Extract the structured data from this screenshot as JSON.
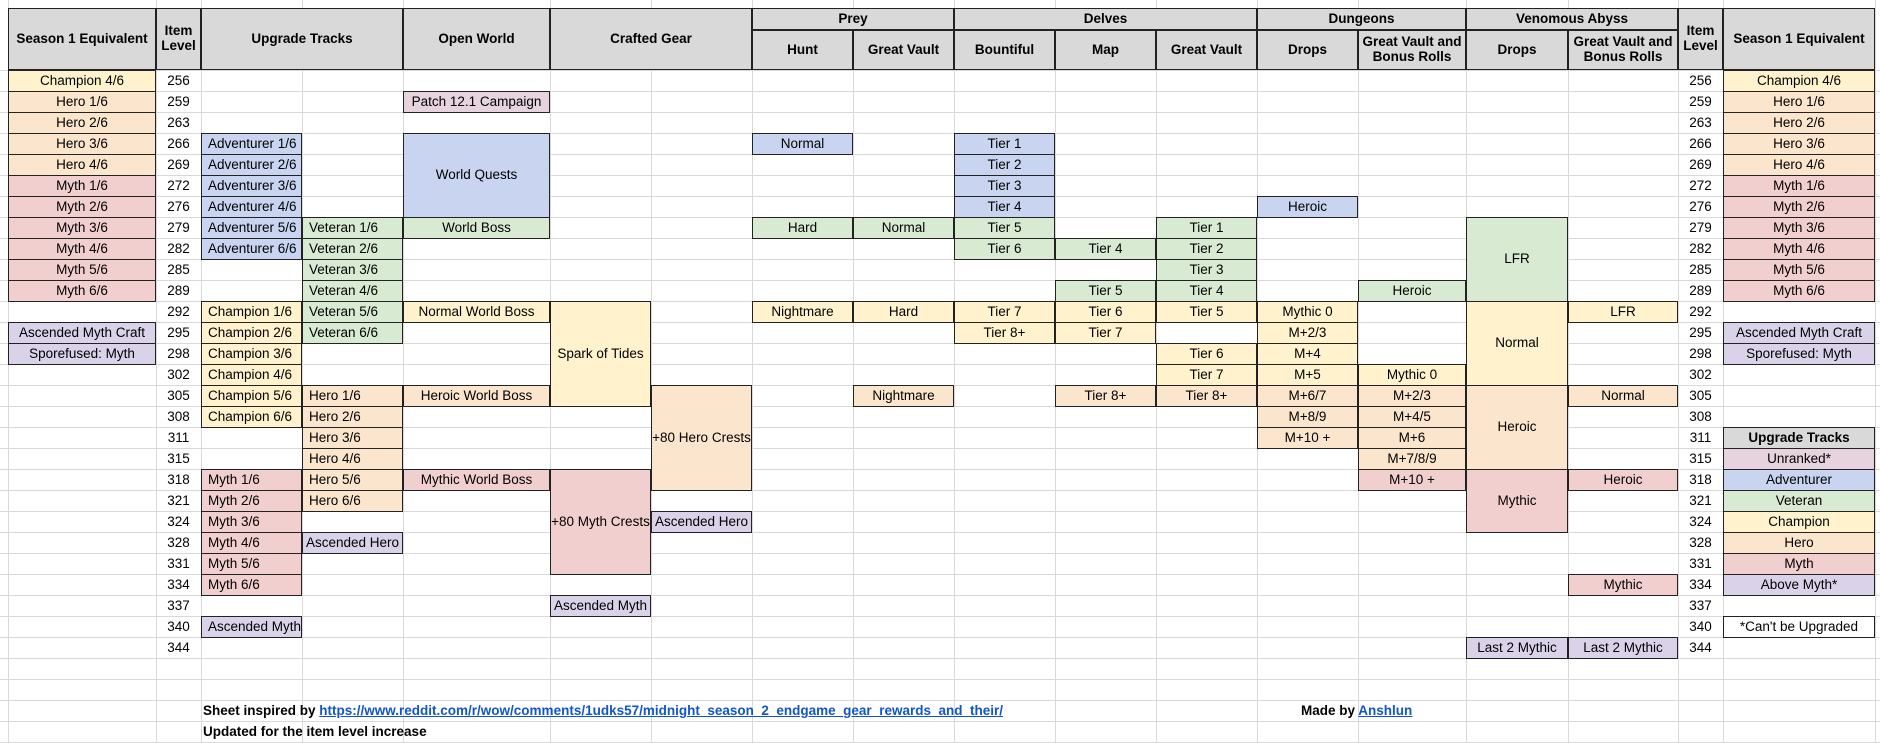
{
  "colors": {
    "header": "#d9d9d9",
    "unranked": "#e6d3dd",
    "adventurer": "#c9d5f0",
    "veteran": "#d9ead3",
    "champion": "#fff2cc",
    "hero": "#fce5cd",
    "myth": "#f2cfcf",
    "above_myth": "#d9d2e9",
    "link": "#1155cc"
  },
  "header": {
    "season_left": "Season 1 Equivalent",
    "item_level_left": "Item Level",
    "upgrade_tracks": "Upgrade Tracks",
    "open_world": "Open World",
    "crafted_gear": "Crafted Gear",
    "prey": "Prey",
    "prey_hunt": "Hunt",
    "prey_great_vault": "Great Vault",
    "delves": "Delves",
    "delves_bountiful": "Bountiful",
    "delves_map": "Map",
    "delves_great_vault": "Great Vault",
    "dungeons": "Dungeons",
    "dungeons_drops": "Drops",
    "dungeons_great_vault": "Great Vault and Bonus Rolls",
    "abyss": "Venomous Abyss",
    "abyss_drops": "Drops",
    "abyss_great_vault": "Great Vault and Bonus Rolls",
    "item_level_right": "Item Level",
    "season_right": "Season 1 Equivalent"
  },
  "item_levels": [
    "256",
    "259",
    "263",
    "266",
    "269",
    "272",
    "276",
    "279",
    "282",
    "285",
    "289",
    "292",
    "295",
    "298",
    "302",
    "305",
    "308",
    "311",
    "315",
    "318",
    "321",
    "324",
    "328",
    "331",
    "334",
    "337",
    "340",
    "344"
  ],
  "season_equivalent": [
    {
      "row": 0,
      "text": "Champion 4/6",
      "color": "champion"
    },
    {
      "row": 1,
      "text": "Hero 1/6",
      "color": "hero"
    },
    {
      "row": 2,
      "text": "Hero 2/6",
      "color": "hero"
    },
    {
      "row": 3,
      "text": "Hero 3/6",
      "color": "hero"
    },
    {
      "row": 4,
      "text": "Hero 4/6",
      "color": "hero"
    },
    {
      "row": 5,
      "text": "Myth 1/6",
      "color": "myth"
    },
    {
      "row": 6,
      "text": "Myth 2/6",
      "color": "myth"
    },
    {
      "row": 7,
      "text": "Myth 3/6",
      "color": "myth"
    },
    {
      "row": 8,
      "text": "Myth 4/6",
      "color": "myth"
    },
    {
      "row": 9,
      "text": "Myth 5/6",
      "color": "myth"
    },
    {
      "row": 10,
      "text": "Myth 6/6",
      "color": "myth"
    },
    {
      "row": 12,
      "text": "Ascended Myth Craft",
      "color": "above_myth"
    },
    {
      "row": 13,
      "text": "Sporefused: Myth",
      "color": "above_myth"
    }
  ],
  "cells": [
    {
      "col": "up1",
      "row": 3,
      "span": 1,
      "text": "Adventurer 1/6",
      "color": "adventurer",
      "align": "left"
    },
    {
      "col": "up1",
      "row": 4,
      "span": 1,
      "text": "Adventurer 2/6",
      "color": "adventurer",
      "align": "left"
    },
    {
      "col": "up1",
      "row": 5,
      "span": 1,
      "text": "Adventurer 3/6",
      "color": "adventurer",
      "align": "left"
    },
    {
      "col": "up1",
      "row": 6,
      "span": 1,
      "text": "Adventurer 4/6",
      "color": "adventurer",
      "align": "left"
    },
    {
      "col": "up1",
      "row": 7,
      "span": 1,
      "text": "Adventurer 5/6",
      "color": "adventurer",
      "align": "left"
    },
    {
      "col": "up1",
      "row": 8,
      "span": 1,
      "text": "Adventurer 6/6",
      "color": "adventurer",
      "align": "left"
    },
    {
      "col": "up1",
      "row": 11,
      "span": 1,
      "text": "Champion 1/6",
      "color": "champion",
      "align": "left"
    },
    {
      "col": "up1",
      "row": 12,
      "span": 1,
      "text": "Champion 2/6",
      "color": "champion",
      "align": "left"
    },
    {
      "col": "up1",
      "row": 13,
      "span": 1,
      "text": "Champion 3/6",
      "color": "champion",
      "align": "left"
    },
    {
      "col": "up1",
      "row": 14,
      "span": 1,
      "text": "Champion 4/6",
      "color": "champion",
      "align": "left"
    },
    {
      "col": "up1",
      "row": 15,
      "span": 1,
      "text": "Champion 5/6",
      "color": "champion",
      "align": "left"
    },
    {
      "col": "up1",
      "row": 16,
      "span": 1,
      "text": "Champion 6/6",
      "color": "champion",
      "align": "left"
    },
    {
      "col": "up1",
      "row": 19,
      "span": 1,
      "text": "Myth 1/6",
      "color": "myth",
      "align": "left"
    },
    {
      "col": "up1",
      "row": 20,
      "span": 1,
      "text": "Myth 2/6",
      "color": "myth",
      "align": "left"
    },
    {
      "col": "up1",
      "row": 21,
      "span": 1,
      "text": "Myth 3/6",
      "color": "myth",
      "align": "left"
    },
    {
      "col": "up1",
      "row": 22,
      "span": 1,
      "text": "Myth 4/6",
      "color": "myth",
      "align": "left"
    },
    {
      "col": "up1",
      "row": 23,
      "span": 1,
      "text": "Myth 5/6",
      "color": "myth",
      "align": "left"
    },
    {
      "col": "up1",
      "row": 24,
      "span": 1,
      "text": "Myth 6/6",
      "color": "myth",
      "align": "left"
    },
    {
      "col": "up1",
      "row": 26,
      "span": 1,
      "text": "Ascended Myth",
      "color": "above_myth",
      "align": "left"
    },
    {
      "col": "up2",
      "row": 7,
      "span": 1,
      "text": "Veteran 1/6",
      "color": "veteran",
      "align": "left"
    },
    {
      "col": "up2",
      "row": 8,
      "span": 1,
      "text": "Veteran 2/6",
      "color": "veteran",
      "align": "left"
    },
    {
      "col": "up2",
      "row": 9,
      "span": 1,
      "text": "Veteran 3/6",
      "color": "veteran",
      "align": "left"
    },
    {
      "col": "up2",
      "row": 10,
      "span": 1,
      "text": "Veteran 4/6",
      "color": "veteran",
      "align": "left"
    },
    {
      "col": "up2",
      "row": 11,
      "span": 1,
      "text": "Veteran 5/6",
      "color": "veteran",
      "align": "left"
    },
    {
      "col": "up2",
      "row": 12,
      "span": 1,
      "text": "Veteran 6/6",
      "color": "veteran",
      "align": "left"
    },
    {
      "col": "up2",
      "row": 15,
      "span": 1,
      "text": "Hero 1/6",
      "color": "hero",
      "align": "left"
    },
    {
      "col": "up2",
      "row": 16,
      "span": 1,
      "text": "Hero 2/6",
      "color": "hero",
      "align": "left"
    },
    {
      "col": "up2",
      "row": 17,
      "span": 1,
      "text": "Hero 3/6",
      "color": "hero",
      "align": "left"
    },
    {
      "col": "up2",
      "row": 18,
      "span": 1,
      "text": "Hero 4/6",
      "color": "hero",
      "align": "left"
    },
    {
      "col": "up2",
      "row": 19,
      "span": 1,
      "text": "Hero 5/6",
      "color": "hero",
      "align": "left"
    },
    {
      "col": "up2",
      "row": 20,
      "span": 1,
      "text": "Hero 6/6",
      "color": "hero",
      "align": "left"
    },
    {
      "col": "up2",
      "row": 22,
      "span": 1,
      "text": "Ascended Hero",
      "color": "above_myth",
      "align": "center"
    },
    {
      "col": "ow",
      "row": 1,
      "span": 1,
      "text": "Patch 12.1 Campaign",
      "color": "unranked",
      "align": "center"
    },
    {
      "col": "ow",
      "row": 3,
      "span": 4,
      "text": "World Quests",
      "color": "adventurer",
      "align": "center"
    },
    {
      "col": "ow",
      "row": 7,
      "span": 1,
      "text": "World Boss",
      "color": "veteran",
      "align": "center"
    },
    {
      "col": "ow",
      "row": 11,
      "span": 1,
      "text": "Normal World Boss",
      "color": "champion",
      "align": "center"
    },
    {
      "col": "ow",
      "row": 15,
      "span": 1,
      "text": "Heroic World Boss",
      "color": "hero",
      "align": "center"
    },
    {
      "col": "ow",
      "row": 19,
      "span": 1,
      "text": "Mythic World Boss",
      "color": "myth",
      "align": "center"
    },
    {
      "col": "cg1",
      "row": 11,
      "span": 5,
      "text": "Spark of Tides",
      "color": "champion",
      "align": "center"
    },
    {
      "col": "cg1",
      "row": 19,
      "span": 5,
      "text": "+80 Myth Crests",
      "color": "myth",
      "align": "center"
    },
    {
      "col": "cg1",
      "row": 25,
      "span": 1,
      "text": "Ascended Myth",
      "color": "above_myth",
      "align": "center"
    },
    {
      "col": "cg2",
      "row": 15,
      "span": 5,
      "text": "+80 Hero Crests",
      "color": "hero",
      "align": "center"
    },
    {
      "col": "cg2",
      "row": 21,
      "span": 1,
      "text": "Ascended Hero",
      "color": "above_myth",
      "align": "center"
    },
    {
      "col": "hunt",
      "row": 3,
      "span": 1,
      "text": "Normal",
      "color": "adventurer",
      "align": "center"
    },
    {
      "col": "hunt",
      "row": 7,
      "span": 1,
      "text": "Hard",
      "color": "veteran",
      "align": "center"
    },
    {
      "col": "hunt",
      "row": 11,
      "span": 1,
      "text": "Nightmare",
      "color": "champion",
      "align": "center"
    },
    {
      "col": "pgv",
      "row": 7,
      "span": 1,
      "text": "Normal",
      "color": "veteran",
      "align": "center"
    },
    {
      "col": "pgv",
      "row": 11,
      "span": 1,
      "text": "Hard",
      "color": "champion",
      "align": "center"
    },
    {
      "col": "pgv",
      "row": 15,
      "span": 1,
      "text": "Nightmare",
      "color": "hero",
      "align": "center"
    },
    {
      "col": "bount",
      "row": 3,
      "span": 1,
      "text": "Tier 1",
      "color": "adventurer",
      "align": "center"
    },
    {
      "col": "bount",
      "row": 4,
      "span": 1,
      "text": "Tier 2",
      "color": "adventurer",
      "align": "center"
    },
    {
      "col": "bount",
      "row": 5,
      "span": 1,
      "text": "Tier 3",
      "color": "adventurer",
      "align": "center"
    },
    {
      "col": "bount",
      "row": 6,
      "span": 1,
      "text": "Tier 4",
      "color": "adventurer",
      "align": "center"
    },
    {
      "col": "bount",
      "row": 7,
      "span": 1,
      "text": "Tier 5",
      "color": "veteran",
      "align": "center"
    },
    {
      "col": "bount",
      "row": 8,
      "span": 1,
      "text": "Tier 6",
      "color": "veteran",
      "align": "center"
    },
    {
      "col": "bount",
      "row": 11,
      "span": 1,
      "text": "Tier 7",
      "color": "champion",
      "align": "center"
    },
    {
      "col": "bount",
      "row": 12,
      "span": 1,
      "text": "Tier 8+",
      "color": "champion",
      "align": "center"
    },
    {
      "col": "map",
      "row": 8,
      "span": 1,
      "text": "Tier 4",
      "color": "veteran",
      "align": "center"
    },
    {
      "col": "map",
      "row": 10,
      "span": 1,
      "text": "Tier 5",
      "color": "veteran",
      "align": "center"
    },
    {
      "col": "map",
      "row": 11,
      "span": 1,
      "text": "Tier 6",
      "color": "champion",
      "align": "center"
    },
    {
      "col": "map",
      "row": 12,
      "span": 1,
      "text": "Tier 7",
      "color": "champion",
      "align": "center"
    },
    {
      "col": "map",
      "row": 15,
      "span": 1,
      "text": "Tier 8+",
      "color": "hero",
      "align": "center"
    },
    {
      "col": "dgv",
      "row": 7,
      "span": 1,
      "text": "Tier 1",
      "color": "veteran",
      "align": "center"
    },
    {
      "col": "dgv",
      "row": 8,
      "span": 1,
      "text": "Tier 2",
      "color": "veteran",
      "align": "center"
    },
    {
      "col": "dgv",
      "row": 9,
      "span": 1,
      "text": "Tier 3",
      "color": "veteran",
      "align": "center"
    },
    {
      "col": "dgv",
      "row": 10,
      "span": 1,
      "text": "Tier 4",
      "color": "veteran",
      "align": "center"
    },
    {
      "col": "dgv",
      "row": 11,
      "span": 1,
      "text": "Tier 5",
      "color": "champion",
      "align": "center"
    },
    {
      "col": "dgv",
      "row": 13,
      "span": 1,
      "text": "Tier 6",
      "color": "champion",
      "align": "center"
    },
    {
      "col": "dgv",
      "row": 14,
      "span": 1,
      "text": "Tier 7",
      "color": "champion",
      "align": "center"
    },
    {
      "col": "dgv",
      "row": 15,
      "span": 1,
      "text": "Tier 8+",
      "color": "hero",
      "align": "center"
    },
    {
      "col": "ddrop",
      "row": 6,
      "span": 1,
      "text": "Heroic",
      "color": "adventurer",
      "align": "center"
    },
    {
      "col": "ddrop",
      "row": 11,
      "span": 1,
      "text": "Mythic 0",
      "color": "champion",
      "align": "center"
    },
    {
      "col": "ddrop",
      "row": 12,
      "span": 1,
      "text": "M+2/3",
      "color": "champion",
      "align": "center"
    },
    {
      "col": "ddrop",
      "row": 13,
      "span": 1,
      "text": "M+4",
      "color": "champion",
      "align": "center"
    },
    {
      "col": "ddrop",
      "row": 14,
      "span": 1,
      "text": "M+5",
      "color": "champion",
      "align": "center"
    },
    {
      "col": "ddrop",
      "row": 15,
      "span": 1,
      "text": "M+6/7",
      "color": "hero",
      "align": "center"
    },
    {
      "col": "ddrop",
      "row": 16,
      "span": 1,
      "text": "M+8/9",
      "color": "hero",
      "align": "center"
    },
    {
      "col": "ddrop",
      "row": 17,
      "span": 1,
      "text": "M+10 +",
      "color": "hero",
      "align": "center"
    },
    {
      "col": "dungv",
      "row": 10,
      "span": 1,
      "text": "Heroic",
      "color": "veteran",
      "align": "center"
    },
    {
      "col": "dungv",
      "row": 14,
      "span": 1,
      "text": "Mythic 0",
      "color": "champion",
      "align": "center"
    },
    {
      "col": "dungv",
      "row": 15,
      "span": 1,
      "text": "M+2/3",
      "color": "hero",
      "align": "center"
    },
    {
      "col": "dungv",
      "row": 16,
      "span": 1,
      "text": "M+4/5",
      "color": "hero",
      "align": "center"
    },
    {
      "col": "dungv",
      "row": 17,
      "span": 1,
      "text": "M+6",
      "color": "hero",
      "align": "center"
    },
    {
      "col": "dungv",
      "row": 18,
      "span": 1,
      "text": "M+7/8/9",
      "color": "hero",
      "align": "center"
    },
    {
      "col": "dungv",
      "row": 19,
      "span": 1,
      "text": "M+10 +",
      "color": "myth",
      "align": "center"
    },
    {
      "col": "adrop",
      "row": 7,
      "span": 4,
      "text": "LFR",
      "color": "veteran",
      "align": "center"
    },
    {
      "col": "adrop",
      "row": 11,
      "span": 4,
      "text": "Normal",
      "color": "champion",
      "align": "center"
    },
    {
      "col": "adrop",
      "row": 15,
      "span": 4,
      "text": "Heroic",
      "color": "hero",
      "align": "center"
    },
    {
      "col": "adrop",
      "row": 19,
      "span": 3,
      "text": "Mythic",
      "color": "myth",
      "align": "center"
    },
    {
      "col": "adrop",
      "row": 27,
      "span": 1,
      "text": "Last 2 Mythic",
      "color": "above_myth",
      "align": "center"
    },
    {
      "col": "agv",
      "row": 11,
      "span": 1,
      "text": "LFR",
      "color": "champion",
      "align": "center"
    },
    {
      "col": "agv",
      "row": 15,
      "span": 1,
      "text": "Normal",
      "color": "hero",
      "align": "center"
    },
    {
      "col": "agv",
      "row": 19,
      "span": 1,
      "text": "Heroic",
      "color": "myth",
      "align": "center"
    },
    {
      "col": "agv",
      "row": 24,
      "span": 1,
      "text": "Mythic",
      "color": "myth",
      "align": "center"
    },
    {
      "col": "agv",
      "row": 27,
      "span": 1,
      "text": "Last 2 Mythic",
      "color": "above_myth",
      "align": "center"
    }
  ],
  "legend": {
    "title": "Upgrade Tracks",
    "items": [
      {
        "text": "Unranked*",
        "color": "unranked"
      },
      {
        "text": "Adventurer",
        "color": "adventurer"
      },
      {
        "text": "Veteran",
        "color": "veteran"
      },
      {
        "text": "Champion",
        "color": "champion"
      },
      {
        "text": "Hero",
        "color": "hero"
      },
      {
        "text": "Myth",
        "color": "myth"
      },
      {
        "text": "Above Myth*",
        "color": "above_myth"
      }
    ],
    "note": "*Can't be Upgraded"
  },
  "footer": {
    "inspired_label": "Sheet inspired by",
    "inspired_link": "https://www.reddit.com/r/wow/comments/1udks57/midnight_season_2_endgame_gear_rewards_and_their/",
    "updated": "Updated for the item level increase",
    "made_by_label": "Made by",
    "made_by_name": "Anshlun"
  }
}
